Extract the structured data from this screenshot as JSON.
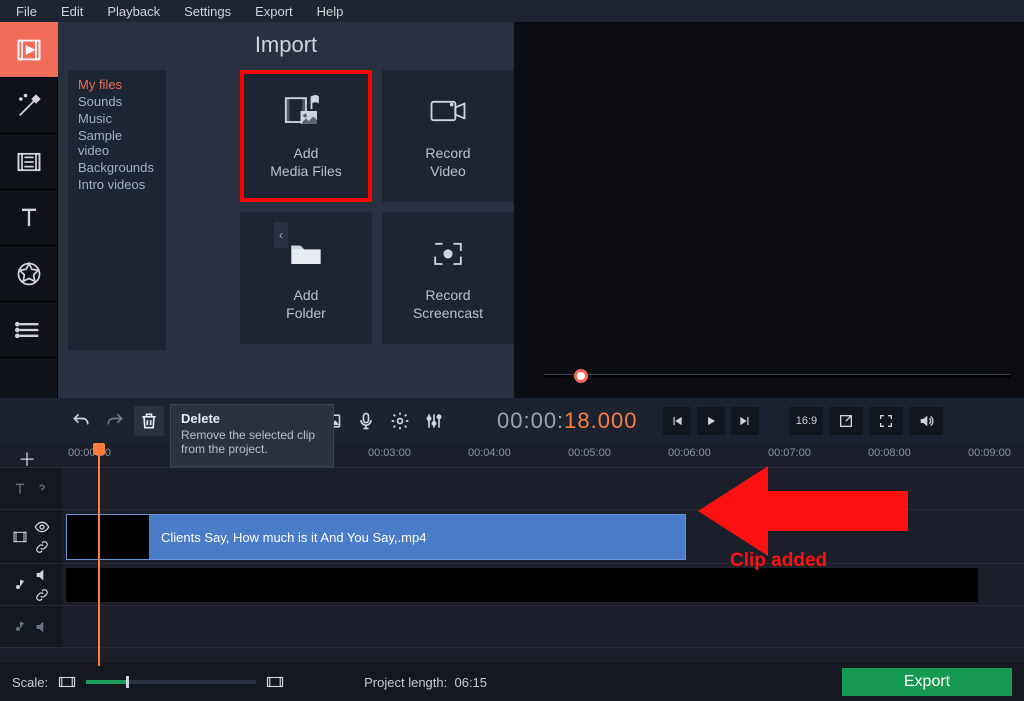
{
  "menu": {
    "file": "File",
    "edit": "Edit",
    "playback": "Playback",
    "settings": "Settings",
    "export": "Export",
    "help": "Help"
  },
  "import": {
    "title": "Import",
    "categories": [
      "My files",
      "Sounds",
      "Music",
      "Sample video",
      "Backgrounds",
      "Intro videos"
    ],
    "tiles": {
      "add_media": "Add\nMedia Files",
      "record_video": "Record\nVideo",
      "add_folder": "Add\nFolder",
      "record_screencast": "Record\nScreencast"
    }
  },
  "toolbar": {
    "tooltip_title": "Delete",
    "tooltip_body": "Remove the selected clip from the project."
  },
  "timecode": {
    "prefix": "00:00:",
    "seconds": "18",
    "millis": ".000"
  },
  "aspect_label": "16:9",
  "timeline": {
    "ticks": [
      "00:00:00",
      "00:03:00",
      "00:04:00",
      "00:05:00",
      "00:06:00",
      "00:07:00",
      "00:08:00",
      "00:09:00"
    ],
    "clip_name": "Clients Say, How much is it And You Say,.mp4"
  },
  "annotation": {
    "label": "Clip added"
  },
  "bottom": {
    "scale": "Scale:",
    "project_length_label": "Project length:",
    "project_length_value": "06:15",
    "export": "Export"
  }
}
